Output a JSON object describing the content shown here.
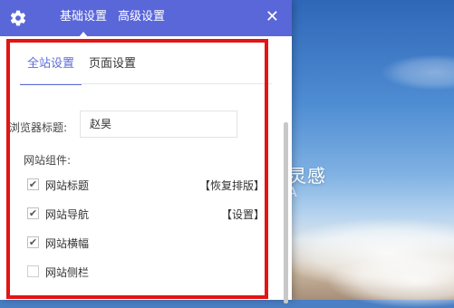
{
  "header": {
    "tabs": [
      {
        "label": "基础设置",
        "active": true
      },
      {
        "label": "高级设置",
        "active": false
      }
    ],
    "close_symbol": "✕"
  },
  "subtabs": [
    {
      "label": "全站设置",
      "active": true
    },
    {
      "label": "页面设置",
      "active": false
    }
  ],
  "form": {
    "browser_title_label": "浏览器标题:",
    "browser_title_value": "赵昊",
    "components_label": "网站组件:",
    "components": [
      {
        "label": "网站标题",
        "checked": true,
        "action": "【恢复排版】"
      },
      {
        "label": "网站导航",
        "checked": true,
        "action": "【设置】"
      },
      {
        "label": "网站横幅",
        "checked": true,
        "action": ""
      },
      {
        "label": "网站侧栏",
        "checked": false,
        "action": ""
      }
    ]
  },
  "background": {
    "text_main": "灵感",
    "text_sub": "A"
  },
  "colors": {
    "header_bg": "#5a67d8",
    "accent": "#5b6dd8",
    "highlight_border": "#e31414"
  },
  "icons": {
    "settings": "gear-icon",
    "close": "close-icon",
    "checkbox_checked": "check-icon"
  }
}
